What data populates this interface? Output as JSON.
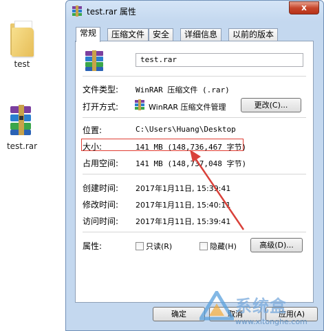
{
  "desktop": {
    "items": [
      {
        "label": "test"
      },
      {
        "label": "test.rar"
      }
    ]
  },
  "window": {
    "title": "test.rar 属性",
    "close_label": "x"
  },
  "tabs": [
    {
      "label": "常规"
    },
    {
      "label": "压缩文件"
    },
    {
      "label": "安全"
    },
    {
      "label": "详细信息"
    },
    {
      "label": "以前的版本"
    }
  ],
  "general": {
    "file_name": "test.rar",
    "file_type_label": "文件类型:",
    "file_type_value": "WinRAR 压缩文件 (.rar)",
    "open_with_label": "打开方式:",
    "open_with_value": "WinRAR 压缩文件管理",
    "change_button": "更改(C)...",
    "location_label": "位置:",
    "location_value": "C:\\Users\\Huang\\Desktop",
    "size_label": "大小:",
    "size_value": "141 MB (148,736,467 字节)",
    "size_on_disk_label": "占用空间:",
    "size_on_disk_value": "141 MB (148,737,048 字节)",
    "created_label": "创建时间:",
    "created_value": "2017年1月11日, 15:39:41",
    "modified_label": "修改时间:",
    "modified_value": "2017年1月11日, 15:40:11",
    "accessed_label": "访问时间:",
    "accessed_value": "2017年1月11日, 15:39:41",
    "attributes_label": "属性:",
    "readonly_label": "只读(R)",
    "hidden_label": "隐藏(H)",
    "advanced_button": "高级(D)..."
  },
  "buttons": {
    "ok": "确定",
    "cancel": "取消",
    "apply": "应用(A)"
  },
  "watermark": {
    "text": "系统盒",
    "url": "www.xitonghe.com"
  },
  "colors": {
    "highlight_box": "#e03c32",
    "arrow": "#d9413a",
    "window_frame": "#c4d8ef"
  }
}
